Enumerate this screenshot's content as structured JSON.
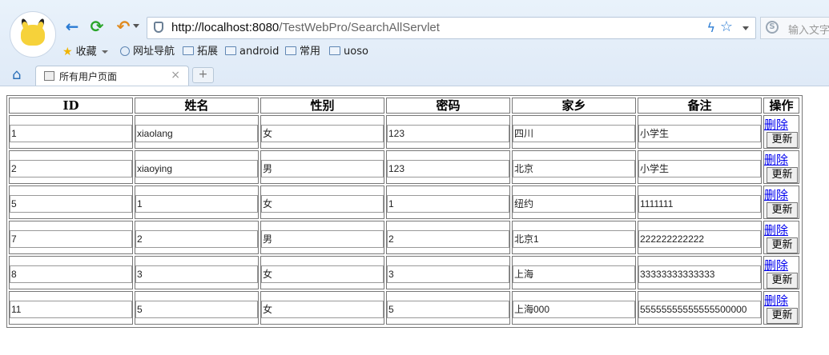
{
  "browser": {
    "url_host": "http://localhost:8080",
    "url_path": "/TestWebPro/SearchAllServlet",
    "search_placeholder": "输入文字",
    "bookmarks": [
      "收藏",
      "网址导航",
      "拓展",
      "android",
      "常用",
      "uoso"
    ],
    "tab_title": "所有用户页面",
    "new_tab_label": "+"
  },
  "table": {
    "headers": [
      "ID",
      "姓名",
      "性别",
      "密码",
      "家乡",
      "备注",
      "操作"
    ],
    "delete_label": "删除",
    "update_label": "更新",
    "rows": [
      [
        "1",
        "xiaolang",
        "女",
        "123",
        "四川",
        "小学生"
      ],
      [
        "2",
        "xiaoying",
        "男",
        "123",
        "北京",
        "小学生"
      ],
      [
        "5",
        "1",
        "女",
        "1",
        "纽约",
        "1111111"
      ],
      [
        "7",
        "2",
        "男",
        "2",
        "北京1",
        "222222222222"
      ],
      [
        "8",
        "3",
        "女",
        "3",
        "上海",
        "33333333333333"
      ],
      [
        "11",
        "5",
        "女",
        "5",
        "上海000",
        "55555555555555500000"
      ]
    ]
  }
}
